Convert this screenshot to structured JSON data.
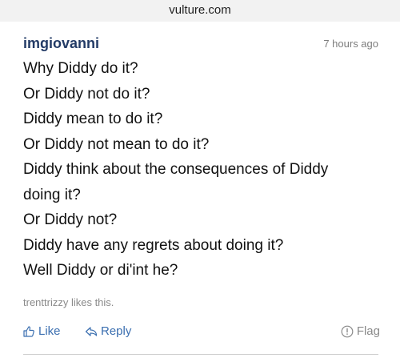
{
  "browser": {
    "url": "vulture.com"
  },
  "comment": {
    "username": "imgiovanni",
    "timestamp": "7 hours ago",
    "lines": [
      "Why Diddy do it?",
      "Or Diddy not do it?",
      "Diddy mean to do it?",
      "Or Diddy not mean to do it?",
      "Diddy think about the consequences of Diddy",
      "doing it?",
      "Or Diddy not?",
      "Diddy have any regrets about doing it?",
      "Well Diddy or di'int he?"
    ],
    "likes_text": "trenttrizzy likes this."
  },
  "actions": {
    "like_label": "Like",
    "reply_label": "Reply",
    "flag_label": "Flag",
    "like_icon": "thumbs-up-icon",
    "reply_icon": "reply-arrow-icon",
    "flag_icon": "exclamation-circle-icon"
  },
  "colors": {
    "username": "#233b66",
    "action_link": "#3b6fb0",
    "muted": "#8a8a8a"
  }
}
